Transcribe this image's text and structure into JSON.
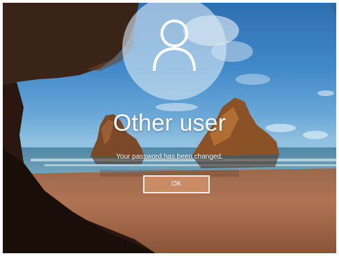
{
  "lockscreen": {
    "username": "Other user",
    "message": "Your password has been changed.",
    "ok_label": "OK"
  },
  "icons": {
    "avatar": "user-avatar-icon"
  },
  "colors": {
    "sky": "#3f88c8",
    "sand": "#a86a46",
    "button_fill": "#c98a66",
    "button_border": "#f3efe8",
    "text": "#ffffff"
  }
}
